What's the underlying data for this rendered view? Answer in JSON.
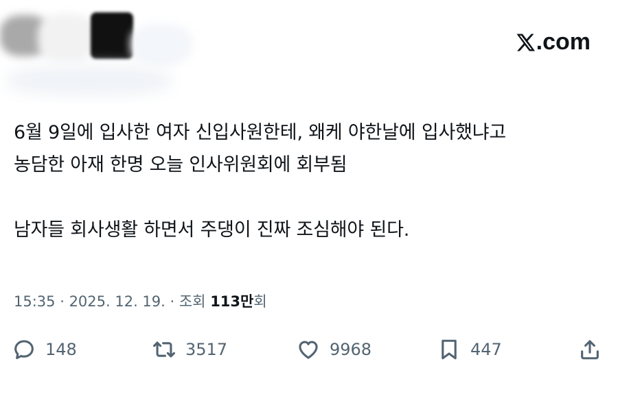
{
  "brand": {
    "logo_icon": "x-logo-icon",
    "domain": ".com"
  },
  "tweet": {
    "lines": [
      "6월 9일에 입사한 여자 신입사원한테, 왜케 야한날에 입사했냐고",
      "농담한 아재 한명 오늘 인사위원회에 회부됨"
    ],
    "line2": "남자들 회사생활 하면서 주댕이 진짜 조심해야 된다."
  },
  "meta": {
    "time": "15:35",
    "separator": " · ",
    "date": "2025. 12. 19.",
    "separator2": " · ",
    "views_label": "조회 ",
    "views_number": "113만",
    "views_suffix": "회"
  },
  "actions": {
    "reply": {
      "icon": "reply-bubble-icon",
      "count": "148"
    },
    "retweet": {
      "icon": "retweet-icon",
      "count": "3517"
    },
    "like": {
      "icon": "heart-icon",
      "count": "9968"
    },
    "bookmark": {
      "icon": "bookmark-icon",
      "count": "447"
    },
    "share": {
      "icon": "share-icon"
    }
  },
  "colors": {
    "text": "#0f1419",
    "secondary": "#536471"
  }
}
